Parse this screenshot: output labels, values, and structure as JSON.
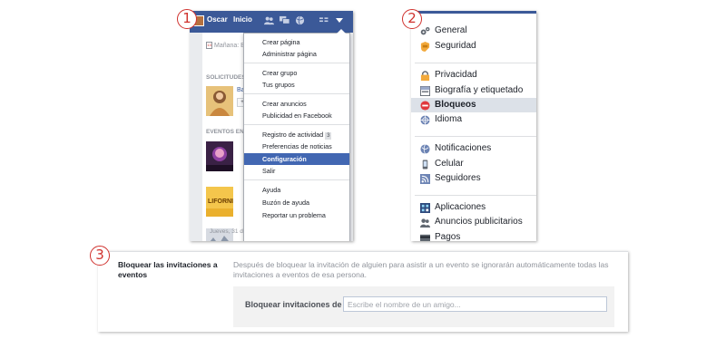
{
  "steps": [
    "1",
    "2",
    "3"
  ],
  "panel1": {
    "topbar": {
      "name": "Oscar",
      "home": "Inicio"
    },
    "left": {
      "date_text": "Mañana: B",
      "requests_label": "SOLICITUDES",
      "request_name": "Ba",
      "events_label": "EVENTOS EN T",
      "event_date": "Jueves, 31 de diciembre en ..."
    },
    "menu": {
      "items": [
        "Crear página",
        "Administrar página",
        "Crear grupo",
        "Tus grupos",
        "Crear anuncios",
        "Publicidad en Facebook",
        "Registro de actividad",
        "Preferencias de noticias",
        "Configuración",
        "Salir",
        "Ayuda",
        "Buzón de ayuda",
        "Reportar un problema"
      ],
      "activity_count": "3",
      "active_item": "Configuración"
    }
  },
  "panel2": {
    "items": [
      {
        "label": "General",
        "icon": "gears-icon"
      },
      {
        "label": "Seguridad",
        "icon": "badge-icon"
      },
      {
        "label": "Privacidad",
        "icon": "lock-icon"
      },
      {
        "label": "Biografía y etiquetado",
        "icon": "timeline-icon"
      },
      {
        "label": "Bloqueos",
        "icon": "block-icon"
      },
      {
        "label": "Idioma",
        "icon": "globe-icon"
      },
      {
        "label": "Notificaciones",
        "icon": "globe-notification-icon"
      },
      {
        "label": "Celular",
        "icon": "phone-icon"
      },
      {
        "label": "Seguidores",
        "icon": "rss-icon"
      },
      {
        "label": "Aplicaciones",
        "icon": "apps-icon"
      },
      {
        "label": "Anuncios publicitarios",
        "icon": "ads-icon"
      },
      {
        "label": "Pagos",
        "icon": "payments-icon"
      }
    ],
    "selected": "Bloqueos"
  },
  "panel3": {
    "label": "Bloquear las invitaciones a eventos",
    "description": "Después de bloquear la invitación de alguien para asistir a un evento se ignorarán automáticamente todas las invitaciones a eventos de esa persona.",
    "field_label": "Bloquear invitaciones de",
    "placeholder": "Escribe el nombre de un amigo..."
  },
  "colors": {
    "fb_blue": "#3b5998",
    "highlight": "#4267b2",
    "step_red": "#d0312d",
    "block_red": "#e0393e"
  }
}
